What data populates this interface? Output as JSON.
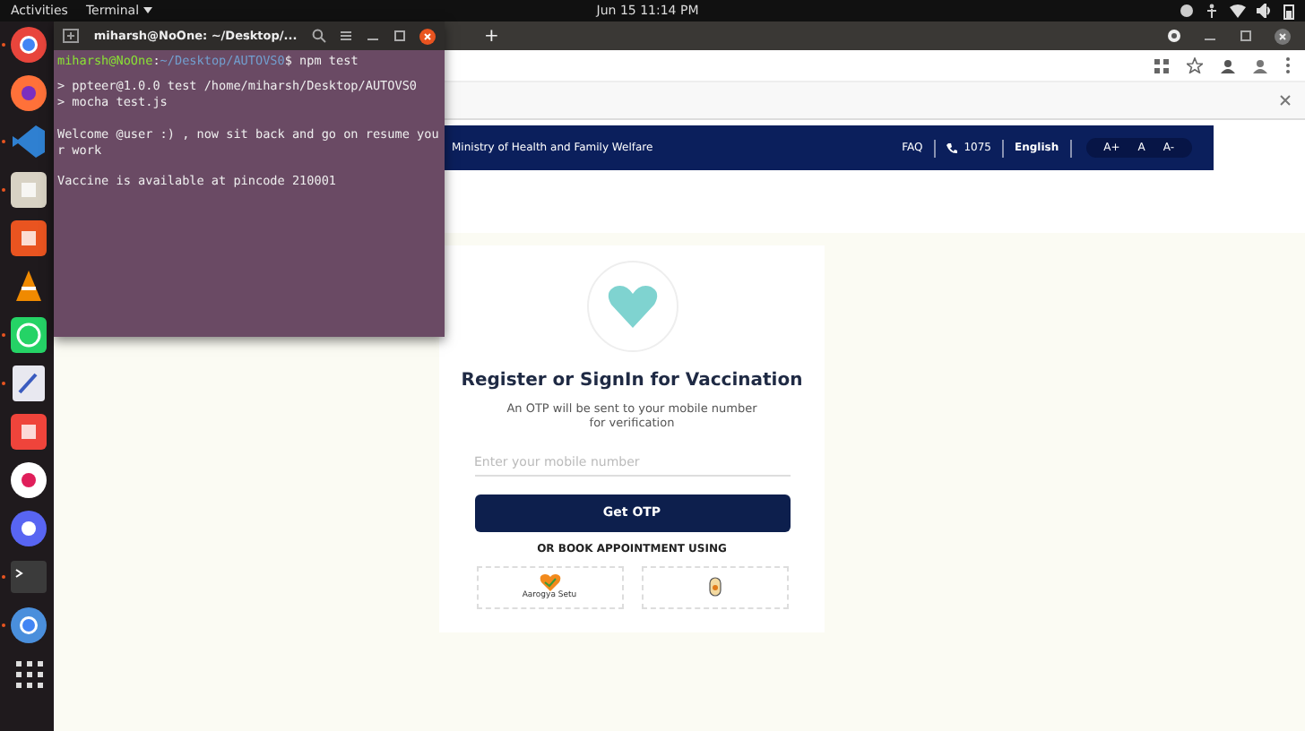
{
  "top_bar": {
    "activities": "Activities",
    "app_menu": "Terminal",
    "clock": "Jun 15  11:14 PM"
  },
  "dock": {
    "items": [
      {
        "kind": "chrome",
        "running": true
      },
      {
        "kind": "firefox",
        "running": false
      },
      {
        "kind": "vscode",
        "running": true
      },
      {
        "kind": "files",
        "running": true
      },
      {
        "kind": "store",
        "running": false
      },
      {
        "kind": "vlc",
        "running": false
      },
      {
        "kind": "whatsapp",
        "running": true
      },
      {
        "kind": "editor",
        "running": true
      },
      {
        "kind": "anydesk",
        "running": false
      },
      {
        "kind": "slack",
        "running": false
      },
      {
        "kind": "discord",
        "running": false
      },
      {
        "kind": "terminal",
        "running": true
      },
      {
        "kind": "chromium",
        "running": true
      },
      {
        "kind": "apps",
        "running": false
      }
    ]
  },
  "browser": {
    "new_tab": "+",
    "header": {
      "ministry": "Ministry of Health and Family Welfare",
      "faq": "FAQ",
      "helpline": "1075",
      "language": "English",
      "font_buttons": [
        "A+",
        "A",
        "A-"
      ]
    },
    "card": {
      "title": "Register or SignIn for Vaccination",
      "subtitle": "An OTP will be sent to your mobile number for verification",
      "mobile_field": {
        "placeholder": "Enter your mobile number"
      },
      "button": "Get OTP",
      "alt_heading": "OR BOOK APPOINTMENT USING",
      "options": [
        {
          "kind": "aarogya",
          "label": "Aarogya Setu"
        },
        {
          "kind": "umang"
        }
      ]
    }
  },
  "terminal": {
    "title": "miharsh@NoOne: ~/Desktop/...",
    "prompt_user": "miharsh@NoOne",
    "prompt_sep": ":",
    "prompt_path": "~/Desktop/AUTOVS0",
    "command": "$ npm test",
    "lines": [
      "> ppteer@1.0.0 test /home/miharsh/Desktop/AUTOVS0",
      "> mocha test.js",
      "Welcome @user :) , now sit back and go on resume your work",
      "Vaccine is available at pincode 210001"
    ]
  }
}
